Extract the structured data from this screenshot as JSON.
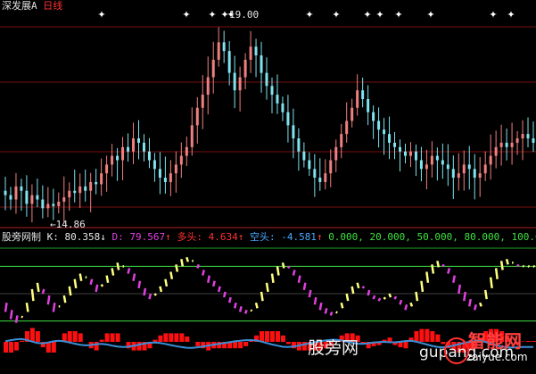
{
  "top_panel": {
    "stock_name": "深发展A",
    "period": "日线",
    "high_marker": "19.00",
    "low_marker": "←14.86"
  },
  "indicator_header": {
    "name": "股旁网制",
    "k_label": "K: 80.358",
    "k_arrow": "↓",
    "d_label": "D: 79.567",
    "d_arrow": "↑",
    "long_label": "多头: 4.634",
    "long_arrow": "↑",
    "short_label": "空头: -4.581",
    "short_arrow": "↑",
    "levels_text": "0.000, 20.000, 50.000, 80.000, 100.000"
  },
  "watermark": {
    "text1": "股旁网",
    "text2": "gupang.com",
    "brand": "智能网",
    "url": "zaiyue.com"
  },
  "colors": {
    "background": "#000000",
    "up_candle": "#f08080",
    "down_candle": "#7fe3f0",
    "kline": "#ffff80",
    "dline": "#e040e0",
    "level_line": "#20c020",
    "bar_red": "#ff1010",
    "blue_line": "#3a90d8",
    "grid_red": "#7a1010",
    "star": "#ffffff"
  },
  "chart_data": [
    {
      "type": "candlestick",
      "title": "深发展A 日线",
      "annotations": [
        "19.00",
        "14.86"
      ],
      "close": [
        15.2,
        15.1,
        15.4,
        15.3,
        15.0,
        15.2,
        15.1,
        14.9,
        15.0,
        14.95,
        15.05,
        15.15,
        15.3,
        15.25,
        15.4,
        15.3,
        15.5,
        15.45,
        15.7,
        15.9,
        16.1,
        16.0,
        16.3,
        16.2,
        16.5,
        16.4,
        16.2,
        16.0,
        15.8,
        15.6,
        15.5,
        15.7,
        15.9,
        16.1,
        16.3,
        16.8,
        17.2,
        17.5,
        17.9,
        18.3,
        18.7,
        18.5,
        18.0,
        17.6,
        17.9,
        18.3,
        18.6,
        18.4,
        18.0,
        17.7,
        17.5,
        17.3,
        17.1,
        16.8,
        16.5,
        16.2,
        16.0,
        15.8,
        15.6,
        15.5,
        15.7,
        16.0,
        16.3,
        16.6,
        16.9,
        17.2,
        17.6,
        17.4,
        17.1,
        16.9,
        16.7,
        16.6,
        16.4,
        16.3,
        16.2,
        16.1,
        16.2,
        16.0,
        15.8,
        15.9,
        16.1,
        16.0,
        15.9,
        15.8,
        15.6,
        15.7,
        15.9,
        15.8,
        15.6,
        15.7,
        15.9,
        16.1,
        16.3,
        16.4,
        16.3,
        16.4,
        16.5,
        16.6,
        16.5,
        16.4
      ],
      "markers_star_count": 14
    },
    {
      "type": "line",
      "title": "股旁网制",
      "series": [
        {
          "name": "K",
          "values": [
            30,
            22,
            18,
            25,
            40,
            55,
            62,
            50,
            38,
            30,
            36,
            48,
            58,
            66,
            72,
            68,
            60,
            52,
            60,
            70,
            78,
            84,
            80,
            72,
            64,
            56,
            48,
            44,
            50,
            58,
            66,
            74,
            82,
            88,
            90,
            86,
            78,
            70,
            62,
            58,
            52,
            46,
            40,
            34,
            30,
            28,
            32,
            40,
            52,
            62,
            72,
            80,
            84,
            78,
            70,
            62,
            54,
            46,
            38,
            32,
            28,
            26,
            30,
            40,
            50,
            58,
            62,
            56,
            48,
            44,
            42,
            46,
            50,
            44,
            38,
            32,
            40,
            52,
            64,
            74,
            82,
            86,
            80,
            72,
            62,
            50,
            42,
            36,
            32,
            40,
            54,
            68,
            78,
            86,
            88,
            84,
            80,
            80.358,
            80.358,
            80.358
          ]
        },
        {
          "name": "D",
          "values": [
            40,
            32,
            26,
            24,
            30,
            42,
            52,
            55,
            48,
            40,
            36,
            40,
            48,
            56,
            64,
            68,
            66,
            60,
            58,
            62,
            70,
            76,
            80,
            78,
            72,
            64,
            56,
            50,
            48,
            52,
            58,
            66,
            74,
            80,
            85,
            86,
            82,
            76,
            70,
            64,
            58,
            52,
            46,
            40,
            36,
            32,
            31,
            34,
            42,
            52,
            62,
            70,
            78,
            80,
            76,
            70,
            62,
            54,
            46,
            40,
            34,
            30,
            29,
            34,
            42,
            50,
            56,
            58,
            54,
            48,
            45,
            44,
            46,
            47,
            43,
            38,
            36,
            42,
            52,
            62,
            72,
            79,
            82,
            78,
            70,
            60,
            52,
            44,
            38,
            36,
            44,
            56,
            66,
            76,
            82,
            84,
            82,
            80,
            79.567,
            79.567
          ]
        }
      ],
      "levels": [
        0,
        20,
        50,
        80,
        100
      ],
      "extra_values": {
        "多头": 4.634,
        "空头": -4.581
      }
    }
  ]
}
